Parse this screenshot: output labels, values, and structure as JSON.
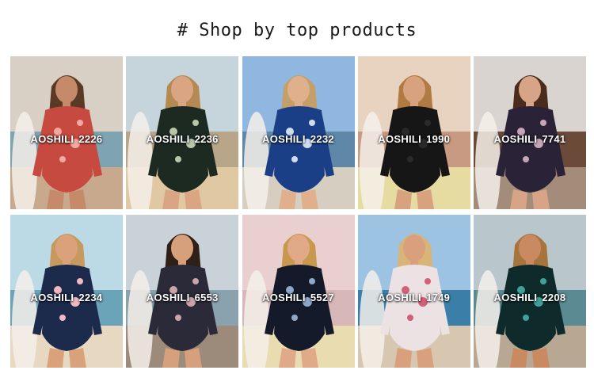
{
  "heading": "# Shop by top products",
  "products": [
    {
      "brand": "AOSHILI",
      "model": "2226",
      "sky": "#d8cfc5",
      "sea": "#7ea3b1",
      "sand": "#c9a98e",
      "suit": "#c64a3f",
      "accent": "#f1a9a0",
      "skin": "#c48a6a",
      "hair": "#5a3a24"
    },
    {
      "brand": "AOSHILI",
      "model": "2236",
      "sky": "#c6d4dc",
      "sea": "#b8a68a",
      "sand": "#e0c9a2",
      "suit": "#1d2a22",
      "accent": "#b9c6a7",
      "skin": "#d9a582",
      "hair": "#b58a52"
    },
    {
      "brand": "AOSHILI",
      "model": "2232",
      "sky": "#8fb7e0",
      "sea": "#5f87a8",
      "sand": "#d7cec2",
      "suit": "#1b3f86",
      "accent": "#d0dcf0",
      "skin": "#e0b08c",
      "hair": "#c4a068"
    },
    {
      "brand": "AOSHILI",
      "model": "1990",
      "sky": "#e8d3c0",
      "sea": "#c99a82",
      "sand": "#e6dca2",
      "suit": "#161616",
      "accent": "#2a2a2a",
      "skin": "#d7a27d",
      "hair": "#b07a42"
    },
    {
      "brand": "AOSHILI",
      "model": "7741",
      "sky": "#d9d4cf",
      "sea": "#6b4a3a",
      "sand": "#a38c7a",
      "suit": "#2a2236",
      "accent": "#c7a4b8",
      "skin": "#d8a488",
      "hair": "#4a2c1c"
    },
    {
      "brand": "AOSHILI",
      "model": "2234",
      "sky": "#bcd9e6",
      "sea": "#6ba4b9",
      "sand": "#e7d8c2",
      "suit": "#1c2a4c",
      "accent": "#f2b9c0",
      "skin": "#d9a27a",
      "hair": "#c69a5e"
    },
    {
      "brand": "AOSHILI",
      "model": "6553",
      "sky": "#c9d2d8",
      "sea": "#8aa2ae",
      "sand": "#9c8b7b",
      "suit": "#2a2a38",
      "accent": "#c9a4a8",
      "skin": "#d7a07d",
      "hair": "#2f1f16"
    },
    {
      "brand": "AOSHILI",
      "model": "5527",
      "sky": "#e9cfcf",
      "sea": "#d8b7b8",
      "sand": "#e8dcb0",
      "suit": "#141a2a",
      "accent": "#8fa7c8",
      "skin": "#e0a988",
      "hair": "#c8984e"
    },
    {
      "brand": "AOSHILI",
      "model": "1749",
      "sky": "#9cc3e2",
      "sea": "#3b7fa8",
      "sand": "#d7c7b0",
      "suit": "#ece2e4",
      "accent": "#d26078",
      "skin": "#d8a07c",
      "hair": "#d9b478"
    },
    {
      "brand": "AOSHILI",
      "model": "2208",
      "sky": "#b9c7cc",
      "sea": "#5c8a92",
      "sand": "#b8a893",
      "suit": "#0e2a2a",
      "accent": "#3fa29a",
      "skin": "#c98a62",
      "hair": "#a8743e"
    }
  ]
}
